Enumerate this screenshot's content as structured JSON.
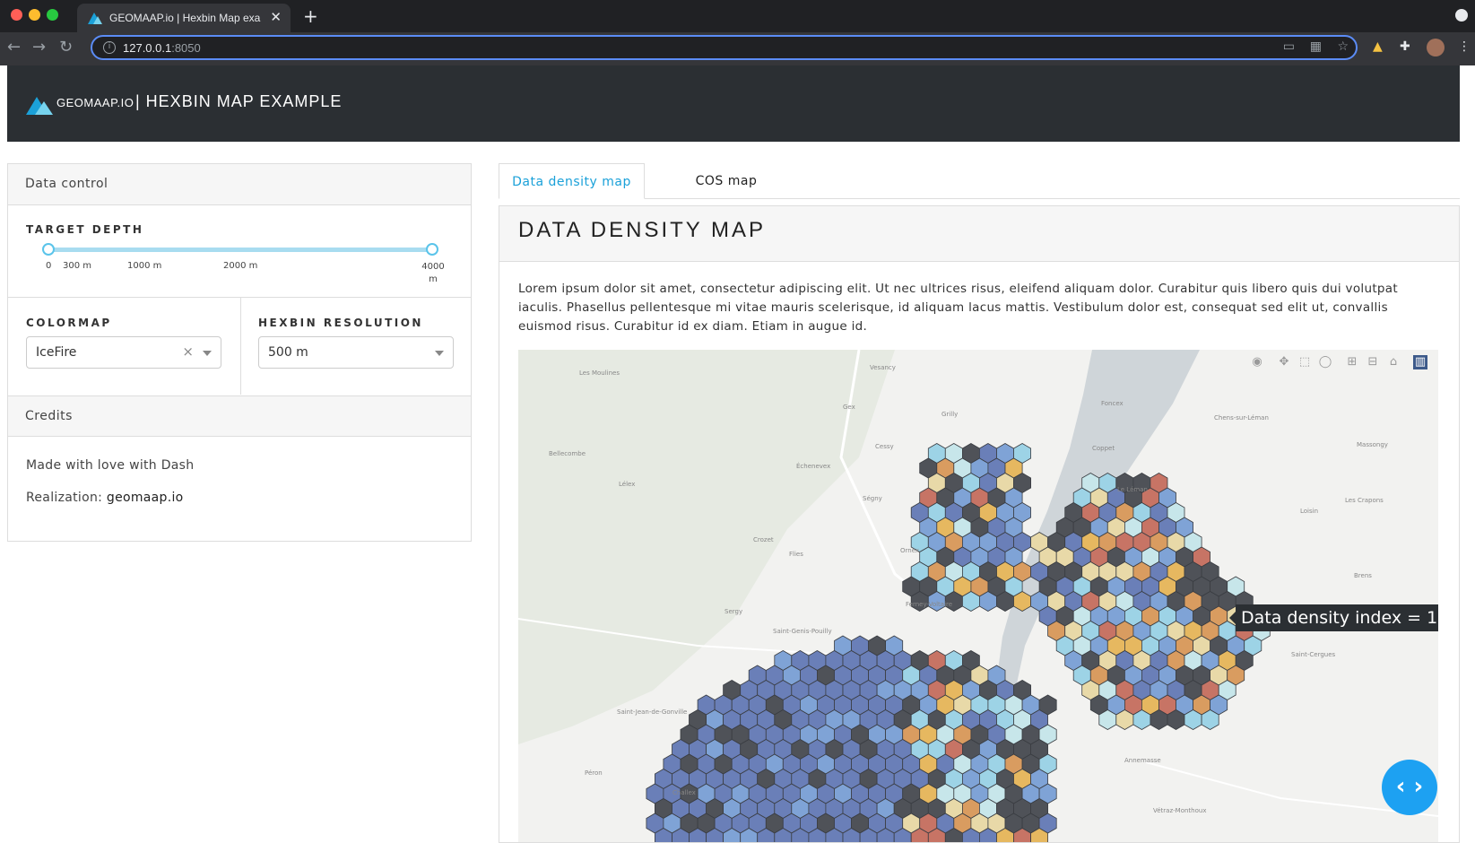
{
  "browser": {
    "tab_title": "GEOMAAP.io | Hexbin Map exa",
    "url_host": "127.0.0.1",
    "url_port": ":8050"
  },
  "header": {
    "brand": "GEOMAAP.IO",
    "title": "| HEXBIN MAP EXAMPLE"
  },
  "left": {
    "data_control_title": "Data control",
    "target_depth": {
      "label": "TARGET DEPTH",
      "ticks": [
        "0",
        "300 m",
        "1000 m",
        "2000 m",
        "4000 m"
      ],
      "range_value": [
        "0",
        "4000"
      ]
    },
    "colormap": {
      "label": "COLORMAP",
      "value": "IceFire"
    },
    "hexbin_resolution": {
      "label": "HEXBIN RESOLUTION",
      "value": "500 m"
    },
    "credits_title": "Credits",
    "credit_line1": "Made with love with Dash",
    "credit_line2_prefix": "Realization: ",
    "credit_line2_link": "geomaap.io"
  },
  "tabs": [
    {
      "label": "Data density map",
      "active": true
    },
    {
      "label": "COS map",
      "active": false
    }
  ],
  "main": {
    "title": "DATA DENSITY MAP",
    "description": "Lorem ipsum dolor sit amet, consectetur adipiscing elit. Ut nec ultrices risus, eleifend aliquam dolor. Curabitur quis libero quis dui volutpat iaculis. Phasellus pellentesque mi vitae mauris scelerisque, id aliquam lacus mattis. Vestibulum dolor est, consequat sed elit ut, convallis euismod risus. Curabitur id ex diam. Etiam in augue id.",
    "tooltip": "Data density index = 1",
    "place_labels": [
      "Vesancy",
      "Les Moulines",
      "Gex",
      "Grilly",
      "Foncex",
      "Chens-sur-Léman",
      "Bellecombe",
      "Échenevex",
      "Cessy",
      "Coppet",
      "Massongy",
      "Lélex",
      "Ségny",
      "Le Léman",
      "Loisin",
      "Les Crapons",
      "Crozet",
      "Flies",
      "Ornex",
      "Brens",
      "Sergy",
      "Ferney-Voltaire",
      "Saint-Genis-Pouilly",
      "Saint-Cergues",
      "Saint-Jean-de-Gonville",
      "Annemasse",
      "Péron",
      "Challex",
      "Vétraz-Monthoux"
    ]
  },
  "colors": {
    "accent": "#1ba1d9",
    "header_bg": "#2b2f33",
    "colormap_icefire": [
      "#4f5258",
      "#6a7fb8",
      "#7fa3d6",
      "#9dd3e6",
      "#c7e6ea",
      "#e8d9a8",
      "#e6b860",
      "#d99c60",
      "#c77465"
    ]
  },
  "icons": [
    "camera-icon",
    "pan-icon",
    "box-select-icon",
    "lasso-icon",
    "zoom-in-icon",
    "zoom-out-icon",
    "home-icon",
    "plotly-logo-icon",
    "code-toggle-icon"
  ]
}
